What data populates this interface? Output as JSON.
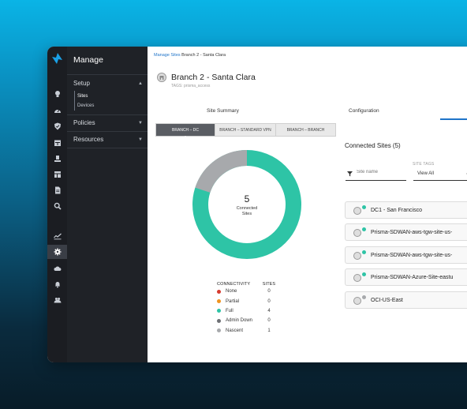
{
  "sidebar": {
    "title": "Manage",
    "sections": [
      {
        "label": "Setup",
        "expanded": true,
        "items": [
          {
            "label": "Sites",
            "current": true
          },
          {
            "label": "Devices",
            "current": false
          }
        ]
      },
      {
        "label": "Policies",
        "expanded": false
      },
      {
        "label": "Resources",
        "expanded": false
      }
    ],
    "rail_icons": [
      "lightbulb-icon",
      "gauge-icon",
      "shield-icon",
      "calendar-icon",
      "user-desk-icon",
      "layout-icon",
      "document-icon",
      "search-icon",
      "analytics-icon",
      "gear-icon",
      "cloud-icon",
      "bell-icon",
      "users-icon"
    ],
    "active_rail_icon": "gear-icon"
  },
  "breadcrumb": {
    "link": "Manage Sites",
    "current": "Branch 2 - Santa Clara"
  },
  "page": {
    "title": "Branch 2 - Santa Clara",
    "tags": "TAGS: prisma_access"
  },
  "tabs": [
    {
      "label": "Site Summary",
      "active": true
    },
    {
      "label": "Configuration",
      "active": false
    }
  ],
  "segments": [
    {
      "label": "BRANCH – DC",
      "active": true
    },
    {
      "label": "BRANCH – STANDARD VPN",
      "active": false
    },
    {
      "label": "BRANCH – BRANCH",
      "active": false
    }
  ],
  "donut": {
    "count": "5",
    "label_line1": "Connected",
    "label_line2": "Sites",
    "full_color": "#2ec4a6",
    "nascent_color": "#a7a9ac"
  },
  "legend": {
    "header_connectivity": "CONNECTIVITY",
    "header_sites": "SITES",
    "rows": [
      {
        "label": "None",
        "count": "0",
        "color": "#d63b2f"
      },
      {
        "label": "Partial",
        "count": "0",
        "color": "#f0931f"
      },
      {
        "label": "Full",
        "count": "4",
        "color": "#2ec4a6"
      },
      {
        "label": "Admin Down",
        "count": "0",
        "color": "#6e7075"
      },
      {
        "label": "Nascent",
        "count": "1",
        "color": "#a7a9ac"
      }
    ]
  },
  "connected_sites": {
    "title": "Connected Sites (5)",
    "search_placeholder": "Site name",
    "site_tags_label": "SITE TAGS",
    "site_tags_value": "View All",
    "sites": [
      {
        "name": "DC1 - San Francisco",
        "status_color": "#2ec4a6"
      },
      {
        "name": "Prisma-SDWAN-aws-tgw-site-us-",
        "status_color": "#2ec4a6"
      },
      {
        "name": "Prisma-SDWAN-aws-tgw-site-us-",
        "status_color": "#2ec4a6"
      },
      {
        "name": "Prisma-SDWAN-Azure-Site-eastu",
        "status_color": "#2ec4a6"
      },
      {
        "name": "OCI-US-East",
        "status_color": "#a7a9ac"
      }
    ]
  }
}
